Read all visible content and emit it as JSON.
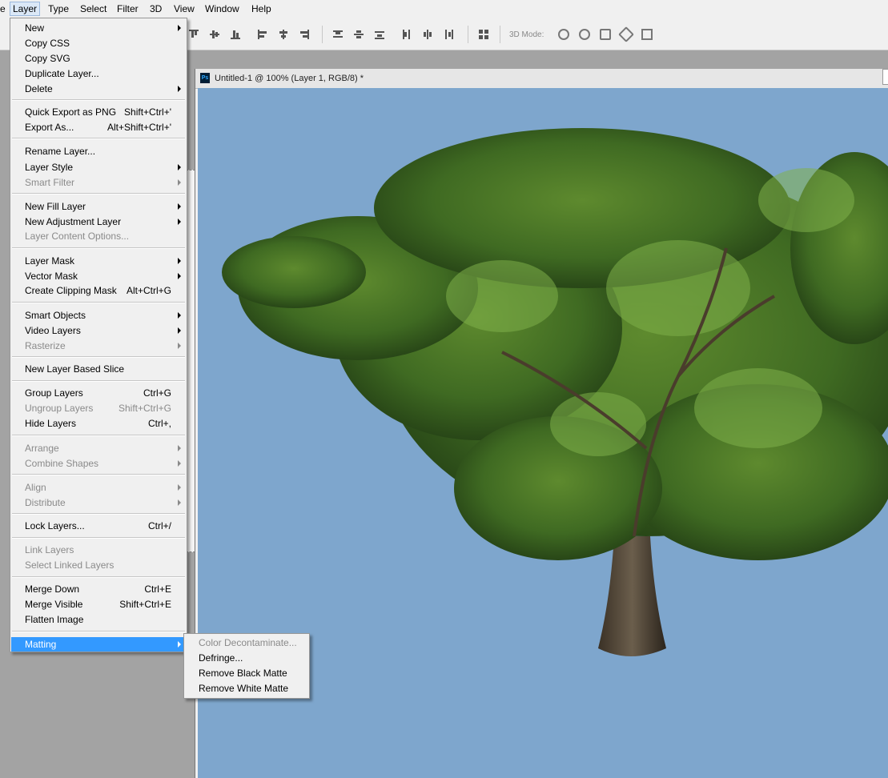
{
  "menubar": {
    "items": [
      {
        "label": "e"
      },
      {
        "label": "Layer"
      },
      {
        "label": "Type"
      },
      {
        "label": "Select"
      },
      {
        "label": "Filter"
      },
      {
        "label": "3D"
      },
      {
        "label": "View"
      },
      {
        "label": "Window"
      },
      {
        "label": "Help"
      }
    ]
  },
  "options_bar": {
    "mode_label": "3D Mode:"
  },
  "document": {
    "title": "Untitled-1 @ 100% (Layer 1, RGB/8) *",
    "ps_logo": "Ps",
    "canvas_color": "#7ea6cd"
  },
  "layer_menu": {
    "items": [
      {
        "label": "New"
      },
      {
        "label": "Copy CSS"
      },
      {
        "label": "Copy SVG"
      },
      {
        "label": "Duplicate Layer..."
      },
      {
        "label": "Delete"
      },
      {
        "label": "Quick Export as PNG",
        "shortcut": "Shift+Ctrl+'"
      },
      {
        "label": "Export As...",
        "shortcut": "Alt+Shift+Ctrl+'"
      },
      {
        "label": "Rename Layer..."
      },
      {
        "label": "Layer Style"
      },
      {
        "label": "Smart Filter"
      },
      {
        "label": "New Fill Layer"
      },
      {
        "label": "New Adjustment Layer"
      },
      {
        "label": "Layer Content Options..."
      },
      {
        "label": "Layer Mask"
      },
      {
        "label": "Vector Mask"
      },
      {
        "label": "Create Clipping Mask",
        "shortcut": "Alt+Ctrl+G"
      },
      {
        "label": "Smart Objects"
      },
      {
        "label": "Video Layers"
      },
      {
        "label": "Rasterize"
      },
      {
        "label": "New Layer Based Slice"
      },
      {
        "label": "Group Layers",
        "shortcut": "Ctrl+G"
      },
      {
        "label": "Ungroup Layers",
        "shortcut": "Shift+Ctrl+G"
      },
      {
        "label": "Hide Layers",
        "shortcut": "Ctrl+,"
      },
      {
        "label": "Arrange"
      },
      {
        "label": "Combine Shapes"
      },
      {
        "label": "Align"
      },
      {
        "label": "Distribute"
      },
      {
        "label": "Lock Layers...",
        "shortcut": "Ctrl+/"
      },
      {
        "label": "Link Layers"
      },
      {
        "label": "Select Linked Layers"
      },
      {
        "label": "Merge Down",
        "shortcut": "Ctrl+E"
      },
      {
        "label": "Merge Visible",
        "shortcut": "Shift+Ctrl+E"
      },
      {
        "label": "Flatten Image"
      },
      {
        "label": "Matting"
      }
    ]
  },
  "matting_submenu": {
    "items": [
      {
        "label": "Color Decontaminate..."
      },
      {
        "label": "Defringe..."
      },
      {
        "label": "Remove Black Matte"
      },
      {
        "label": "Remove White Matte"
      }
    ]
  },
  "colors": {
    "highlight": "#3399ff",
    "menu_bg": "#f0f0f0",
    "disabled_text": "#8a8a8a"
  }
}
